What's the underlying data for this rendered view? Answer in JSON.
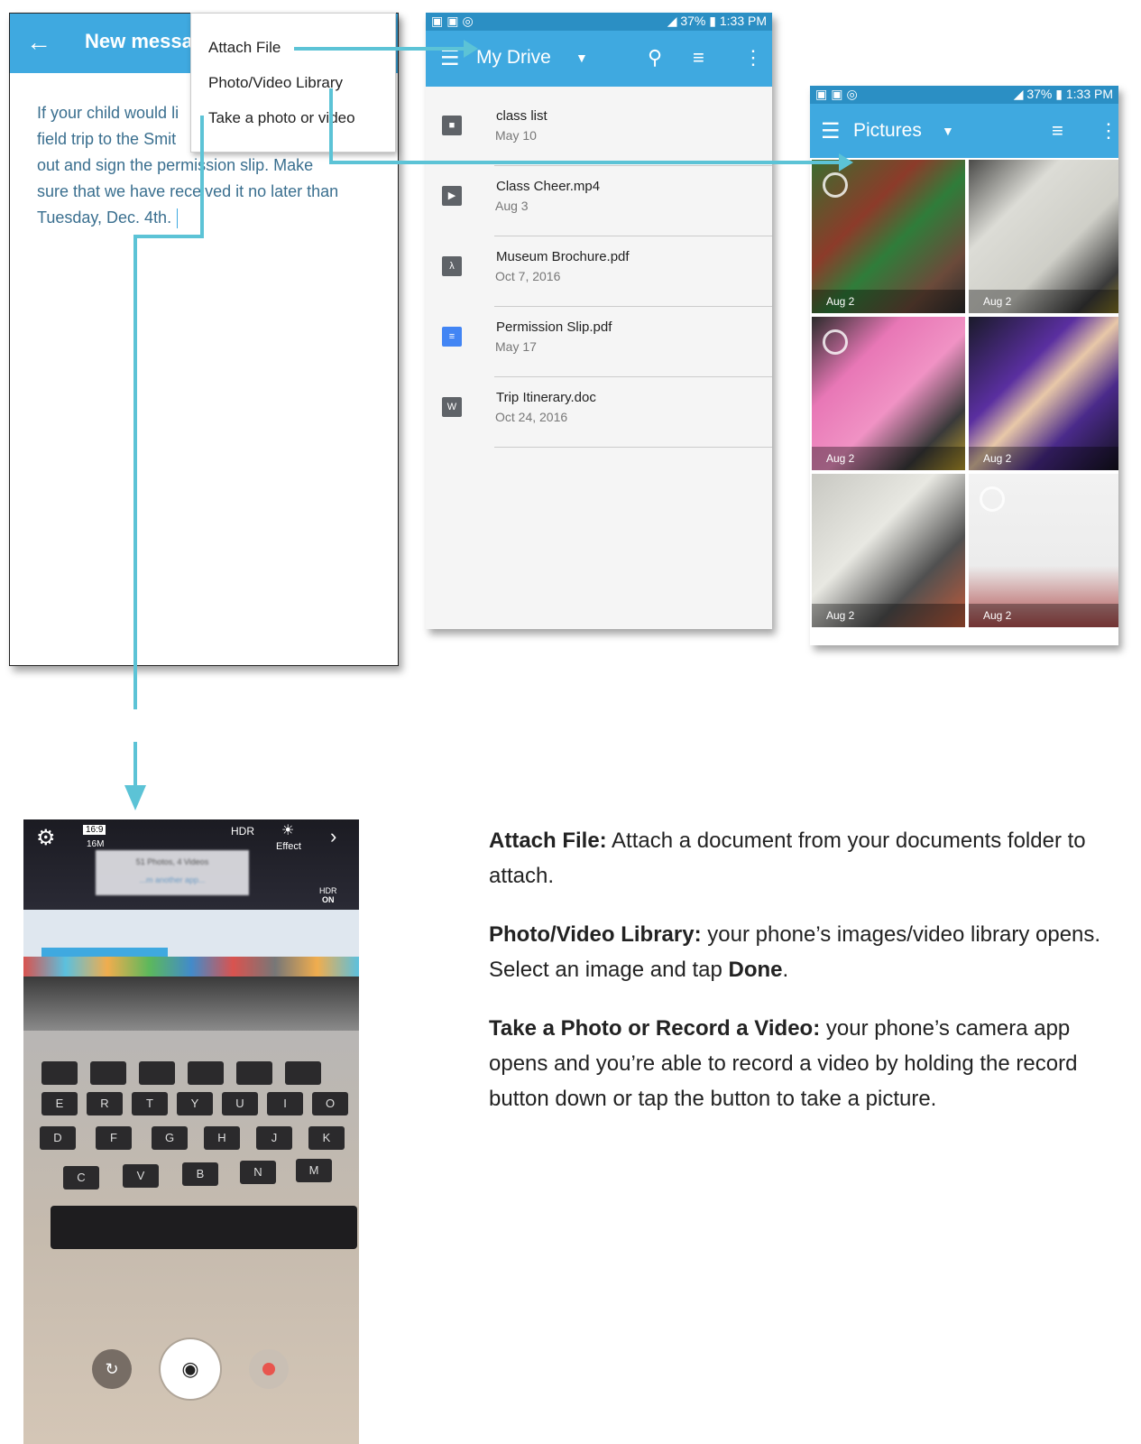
{
  "compose": {
    "back_icon": "arrow-left-icon",
    "title": "New messa",
    "body_text": "If your child would li  field trip to th e Smit  out and sign the permission slip. Make sure that we have received it no later than Tuesday, Dec. 4th.",
    "body_lines": [
      "If your child would li",
      "field trip to the Smit",
      "out and sign the permission slip. Make",
      "sure that we have received it no later than",
      "Tuesday, Dec. 4th."
    ]
  },
  "attach_menu": {
    "items": [
      "Attach File",
      "Photo/Video Library",
      "Take a photo or video"
    ]
  },
  "drive": {
    "status": {
      "time": "1:33 PM",
      "battery": "37%"
    },
    "title": "My Drive",
    "files": [
      {
        "name": "class list",
        "date": "May 10",
        "icon": "folder-icon",
        "color": "#5f6368"
      },
      {
        "name": "Class Cheer.mp4",
        "date": "Aug 3",
        "icon": "video-icon",
        "color": "#5f6368"
      },
      {
        "name": "Museum Brochure.pdf",
        "date": "Oct 7, 2016",
        "icon": "pdf-icon",
        "color": "#5f6368"
      },
      {
        "name": "Permission Slip.pdf",
        "date": "May 17",
        "icon": "doc-icon",
        "color": "#4285f4"
      },
      {
        "name": "Trip Itinerary.doc",
        "date": "Oct 24, 2016",
        "icon": "word-icon",
        "color": "#5f6368"
      }
    ]
  },
  "pictures": {
    "status": {
      "time": "1:33 PM",
      "battery": "37%"
    },
    "title": "Pictures",
    "tiles": [
      "Aug 2",
      "Aug 2",
      "Aug 2",
      "Aug 2",
      "Aug 2",
      "Aug 2"
    ]
  },
  "camera": {
    "ratio": "16:9",
    "resolution": "16M",
    "hdr": "HDR",
    "effect": "Effect",
    "hdr_badge": "HDR",
    "hdr_state": "ON",
    "popup_text": "51 Photos, 4 Videos",
    "popup_sub": "...m another app...",
    "keys_row1": [
      "E",
      "R",
      "T",
      "Y",
      "U",
      "I",
      "O"
    ],
    "keys_row2": [
      "D",
      "F",
      "G",
      "H",
      "J",
      "K"
    ],
    "keys_row3": [
      "C",
      "V",
      "B",
      "N",
      "M"
    ]
  },
  "description": {
    "items": [
      {
        "label": "Attach File:",
        "text": " Attach a document from your documents folder to attach."
      },
      {
        "label": "Photo/Video Library:",
        "text": " your phone’s images/video library opens. Select an image and tap ",
        "bold2": "Done",
        "end": "."
      },
      {
        "label": "Take a Photo or Record a Video:",
        "text": " your phone’s camera app opens and you’re able to record a video by holding the record button down or tap the button to take a picture."
      }
    ]
  },
  "colors": {
    "accent": "#3fa9e0",
    "arrow": "#5cc3d6"
  }
}
